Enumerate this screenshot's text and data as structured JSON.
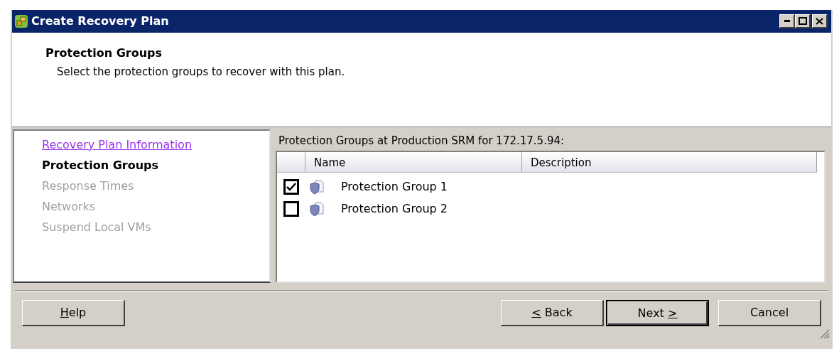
{
  "window": {
    "title": "Create Recovery Plan"
  },
  "header": {
    "title": "Protection Groups",
    "subtitle": "Select the protection groups to recover with this plan."
  },
  "steps": [
    {
      "label": "Recovery Plan Information",
      "kind": "visited"
    },
    {
      "label": "Protection Groups",
      "kind": "current"
    },
    {
      "label": "Response Times",
      "kind": "disabled"
    },
    {
      "label": "Networks",
      "kind": "disabled"
    },
    {
      "label": "Suspend Local VMs",
      "kind": "disabled"
    }
  ],
  "panel": {
    "caption": "Protection Groups at Production SRM for 172.17.5.94:",
    "columns": [
      "Name",
      "Description"
    ],
    "rows": [
      {
        "name": "Protection Group 1",
        "checked": true
      },
      {
        "name": "Protection Group 2",
        "checked": false
      }
    ]
  },
  "help_button": {
    "key": "H",
    "after": "elp",
    "default": false
  },
  "buttons": [
    {
      "key": "<",
      "after": " Back",
      "default": false
    },
    {
      "before": "Next ",
      "key": ">",
      "default": true
    },
    {
      "before": "Cancel",
      "default": false
    }
  ]
}
